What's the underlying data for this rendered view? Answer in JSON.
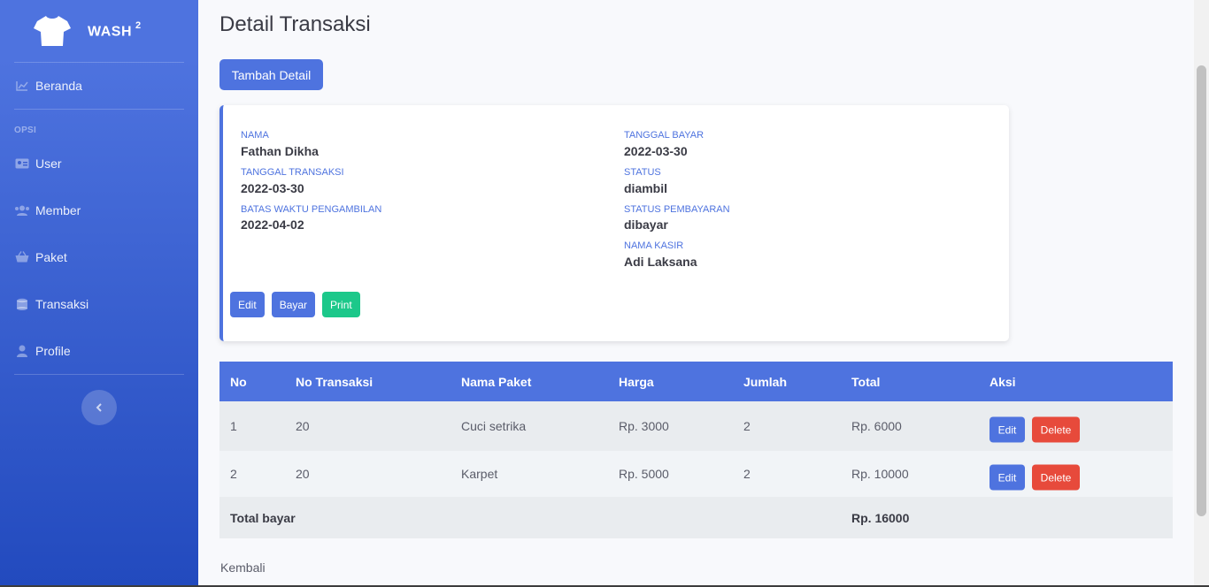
{
  "sidebar": {
    "brand": "WASH",
    "brand_sup": "2",
    "items": [
      {
        "label": "Beranda",
        "icon": "chart-area-icon"
      },
      {
        "label": "User",
        "icon": "id-card-icon"
      },
      {
        "label": "Member",
        "icon": "users-icon"
      },
      {
        "label": "Paket",
        "icon": "basket-icon"
      },
      {
        "label": "Transaksi",
        "icon": "coins-icon"
      },
      {
        "label": "Profile",
        "icon": "user-icon"
      }
    ],
    "heading": "OPSI",
    "toggle_icon": "chevron-left-icon"
  },
  "page": {
    "title": "Detail Transaksi",
    "add_button": "Tambah Detail",
    "back_link": "Kembali"
  },
  "card": {
    "left": [
      {
        "label": "NAMA",
        "value": "Fathan Dikha"
      },
      {
        "label": "TANGGAL TRANSAKSI",
        "value": "2022-03-30"
      },
      {
        "label": "BATAS WAKTU PENGAMBILAN",
        "value": "2022-04-02"
      }
    ],
    "right": [
      {
        "label": "TANGGAL BAYAR",
        "value": "2022-03-30"
      },
      {
        "label": "STATUS",
        "value": "diambil"
      },
      {
        "label": "STATUS PEMBAYARAN",
        "value": "dibayar"
      },
      {
        "label": "NAMA KASIR",
        "value": "Adi Laksana"
      }
    ],
    "buttons": {
      "edit": "Edit",
      "bayar": "Bayar",
      "print": "Print"
    }
  },
  "table": {
    "headers": [
      "No",
      "No Transaksi",
      "Nama Paket",
      "Harga",
      "Jumlah",
      "Total",
      "Aksi"
    ],
    "rows": [
      {
        "no": "1",
        "no_transaksi": "20",
        "nama_paket": "Cuci setrika",
        "harga": "Rp. 3000",
        "jumlah": "2",
        "total": "Rp. 6000"
      },
      {
        "no": "2",
        "no_transaksi": "20",
        "nama_paket": "Karpet",
        "harga": "Rp. 5000",
        "jumlah": "2",
        "total": "Rp. 10000"
      }
    ],
    "row_actions": {
      "edit": "Edit",
      "delete": "Delete"
    },
    "total_label": "Total bayar",
    "total_value": "Rp. 16000"
  },
  "colors": {
    "primary": "#4e73df",
    "success": "#1cc88a",
    "danger": "#e74a3b"
  }
}
